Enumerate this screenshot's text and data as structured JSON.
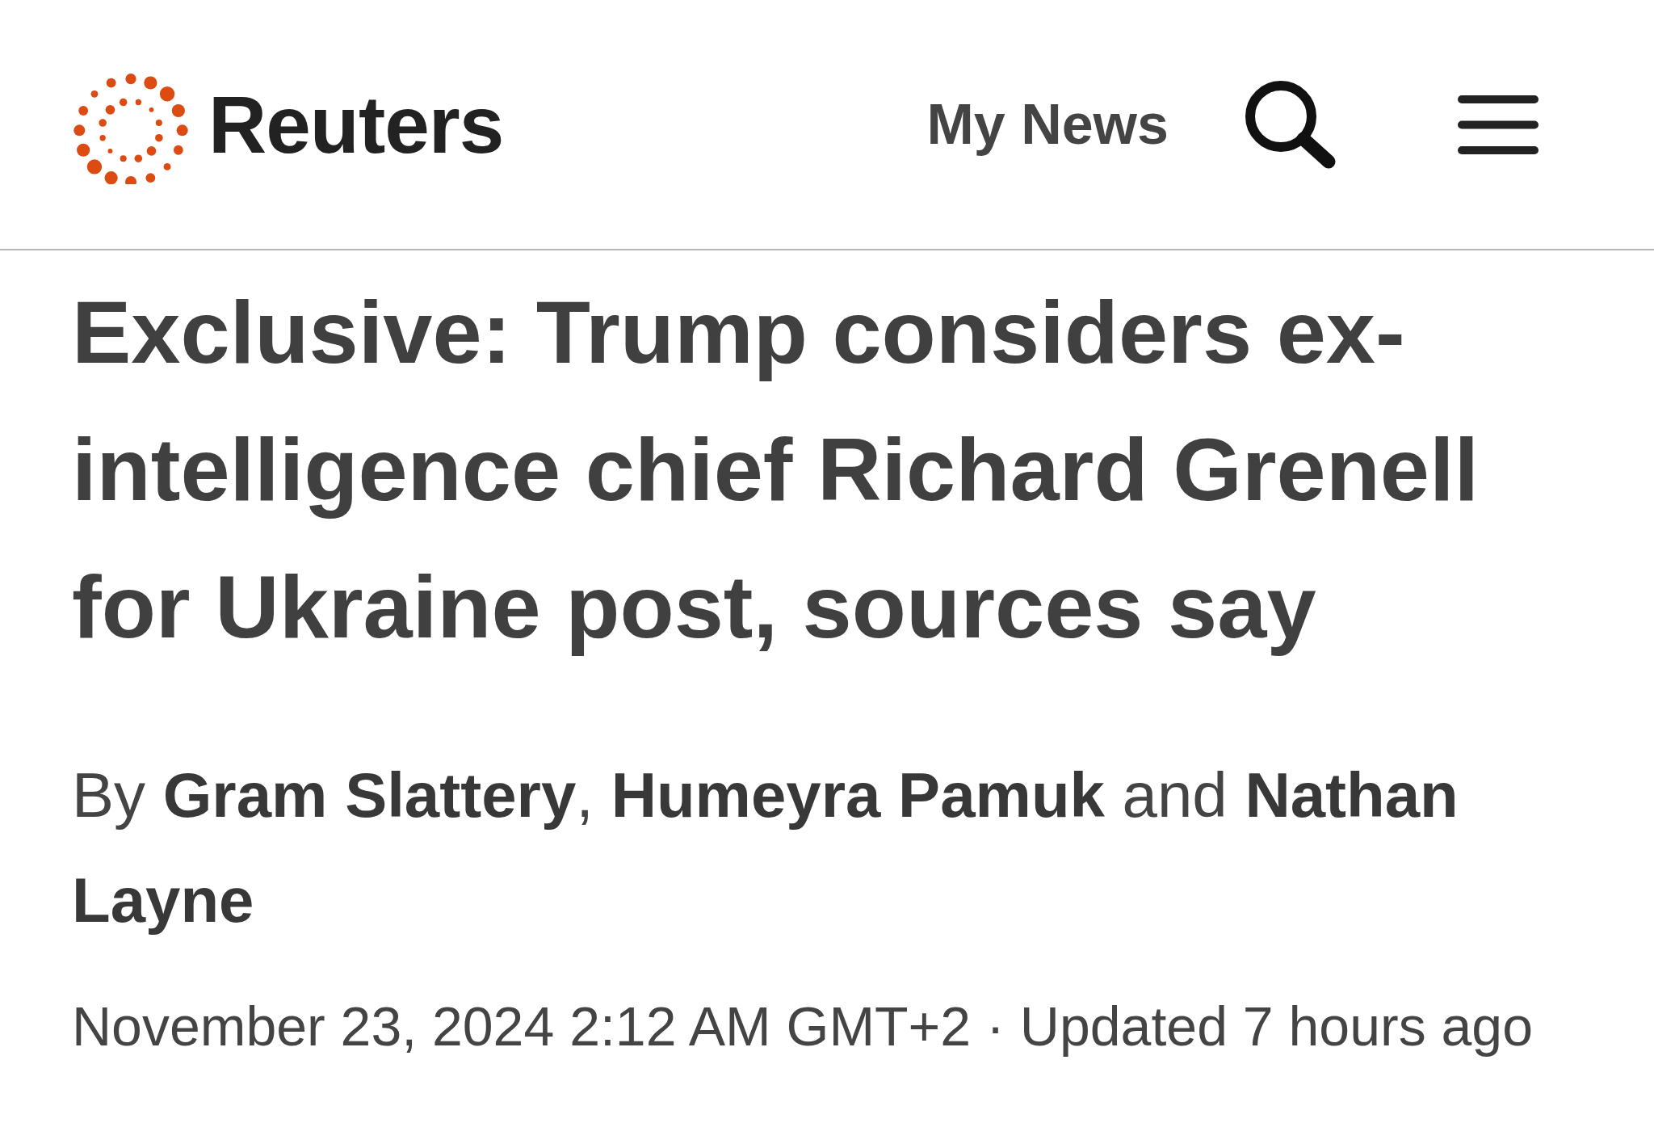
{
  "header": {
    "logo": {
      "wordmark": "Reuters"
    },
    "nav_link": "My News"
  },
  "article": {
    "headline": "Exclusive: Trump considers ex-intelligence chief Richard Grenell for Ukraine post, sources say",
    "byline": "By **Gram Slattery**, **Humeyra Pamuk** and **Nathan Layne**",
    "published": "November 23, 2024 2:12 AM GMT+2",
    "separator": "·",
    "updated": "Updated 7 hours ago"
  }
}
